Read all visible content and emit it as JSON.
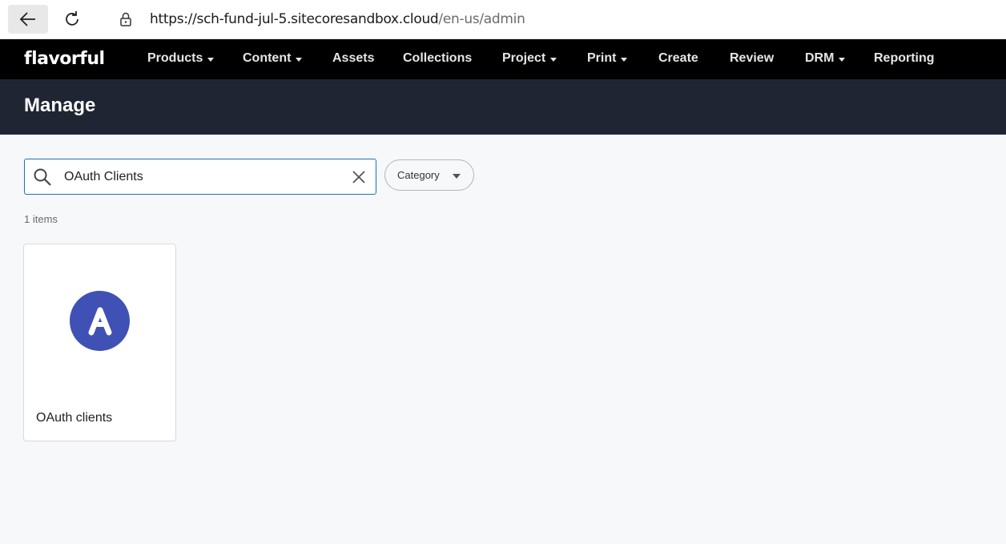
{
  "browser": {
    "url_main": "https://sch-fund-jul-5.sitecoresandbox.cloud",
    "url_path": "/en-us/admin"
  },
  "nav": {
    "logo": "flavorful",
    "items": [
      {
        "label": "Products",
        "dropdown": true
      },
      {
        "label": "Content",
        "dropdown": true
      },
      {
        "label": "Assets",
        "dropdown": false
      },
      {
        "label": "Collections",
        "dropdown": false
      },
      {
        "label": "Project",
        "dropdown": true
      },
      {
        "label": "Print",
        "dropdown": true
      },
      {
        "label": "Create",
        "dropdown": false
      },
      {
        "label": "Review",
        "dropdown": false
      },
      {
        "label": "DRM",
        "dropdown": true
      },
      {
        "label": "Reporting",
        "dropdown": false
      }
    ]
  },
  "page": {
    "title": "Manage"
  },
  "search": {
    "value": "OAuth Clients",
    "category_label": "Category"
  },
  "results": {
    "count_text": "1 items",
    "cards": [
      {
        "label": "OAuth clients",
        "avatar_letter": "A",
        "avatar_color": "#3f51b5"
      }
    ]
  }
}
